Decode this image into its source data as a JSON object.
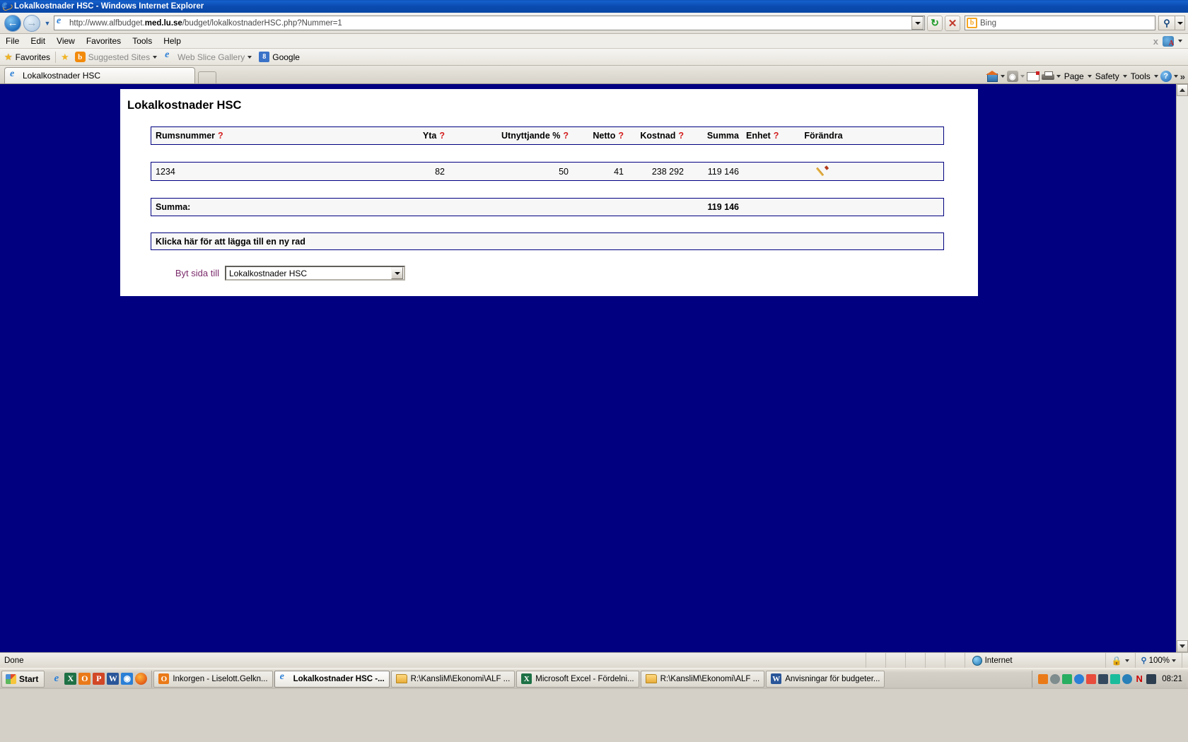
{
  "window": {
    "title": "Lokalkostnader HSC - Windows Internet Explorer",
    "ie_icon": "ie-logo-icon"
  },
  "navigation": {
    "back_icon": "back-arrow-icon",
    "forward_icon": "forward-arrow-icon",
    "history_icon": "chevron-down-icon",
    "address_prefix": "http://www.alfbudget.",
    "address_bold": "med.lu.se",
    "address_suffix": "/budget/lokalkostnaderHSC.php?Nummer=1",
    "address_full": "http://www.alfbudget.med.lu.se/budget/lokalkostnaderHSC.php?Nummer=1",
    "refresh_icon": "refresh-icon",
    "stop_icon": "stop-icon",
    "search_engine": "Bing",
    "search_placeholder": "Bing",
    "search_go_icon": "search-icon",
    "search_dropdown_icon": "chevron-down-icon"
  },
  "menubar": {
    "items": [
      "File",
      "Edit",
      "View",
      "Favorites",
      "Tools",
      "Help"
    ],
    "close_x": "x",
    "pdf_icon": "adobe-pdf-icon"
  },
  "favorites_bar": {
    "favorites_label": "Favorites",
    "add_icon": "add-favorite-icon",
    "items": [
      {
        "label": "Suggested Sites",
        "icon": "orange-o-icon",
        "has_caret": true
      },
      {
        "label": "Web Slice Gallery",
        "icon": "ie-icon",
        "has_caret": true
      },
      {
        "label": "Google",
        "icon": "google-icon",
        "has_caret": false
      }
    ]
  },
  "tabs": {
    "items": [
      {
        "label": "Lokalkostnader HSC",
        "icon": "ie-icon",
        "active": true
      }
    ],
    "new_tab_label": ""
  },
  "command_bar": {
    "home_icon": "home-icon",
    "feeds_icon": "rss-feeds-icon",
    "mail_icon": "mail-icon",
    "print_icon": "print-icon",
    "page_label": "Page",
    "safety_label": "Safety",
    "tools_label": "Tools",
    "help_icon": "help-icon",
    "overflow_label": "»"
  },
  "page": {
    "title": "Lokalkostnader HSC",
    "table": {
      "headers": [
        {
          "label": "Rumsnummer",
          "help": "?"
        },
        {
          "label": "Yta",
          "help": "?"
        },
        {
          "label": "Utnyttjande %",
          "help": "?"
        },
        {
          "label": "Netto",
          "help": "?"
        },
        {
          "label": "Kostnad",
          "help": "?"
        },
        {
          "label": "Summa",
          "help": ""
        },
        {
          "label": "Enhet",
          "help": "?"
        },
        {
          "label": "Förändra",
          "help": ""
        }
      ],
      "rows": [
        {
          "rumsnummer": "1234",
          "yta": "82",
          "utnyttjande": "50",
          "netto": "41",
          "kostnad": "238 292",
          "summa": "119 146",
          "enhet": "",
          "edit_icon": "pencil-edit-icon"
        }
      ],
      "sum_label": "Summa:",
      "sum_value": "119 146",
      "add_row_label": "Klicka här för att lägga till en ny rad"
    },
    "page_switch": {
      "label": "Byt sida till",
      "selected": "Lokalkostnader HSC",
      "dropdown_icon": "chevron-down-icon"
    },
    "colors": {
      "desktop_blue": "#000080",
      "border_navy": "#000080",
      "help_red": "#d42020",
      "label_purple": "#7b2b6b"
    }
  },
  "status_bar": {
    "text": "Done",
    "zone_label": "Internet",
    "zone_icon": "globe-icon",
    "protected_icon": "protected-mode-icon",
    "zoom_icon": "magnifier-icon",
    "zoom_level": "100%",
    "zoom_caret": "chevron-down-icon"
  },
  "taskbar": {
    "start_label": "Start",
    "quick_launch": [
      {
        "icon": "ie-icon",
        "name": "internet-explorer"
      },
      {
        "icon": "excel-icon",
        "name": "excel",
        "letter": "X"
      },
      {
        "icon": "outlook-icon",
        "name": "outlook",
        "letter": "O"
      },
      {
        "icon": "powerpoint-icon",
        "name": "powerpoint",
        "letter": "P"
      },
      {
        "icon": "word-icon",
        "name": "word",
        "letter": "W"
      },
      {
        "icon": "media-icon",
        "name": "media",
        "letter": "▶"
      },
      {
        "icon": "firefox-icon",
        "name": "firefox",
        "letter": ""
      }
    ],
    "tasks": [
      {
        "label": "Inkorgen - Liselott.Gelkn...",
        "icon": "outlook-icon",
        "active": false
      },
      {
        "label": "Lokalkostnader HSC -...",
        "icon": "ie-icon",
        "active": true
      },
      {
        "label": "R:\\KansliM\\Ekonomi\\ALF ...",
        "icon": "folder-icon",
        "active": false
      },
      {
        "label": "Microsoft Excel - Fördelni...",
        "icon": "excel-icon",
        "active": false
      },
      {
        "label": "R:\\KansliM\\Ekonomi\\ALF ...",
        "icon": "folder-icon",
        "active": false
      },
      {
        "label": "Anvisningar för budgeter...",
        "icon": "word-icon",
        "active": false
      }
    ],
    "clock": "08:21",
    "tray_icons": [
      "outlook-tray",
      "shield-tray",
      "network-tray",
      "sound-tray",
      "media-tray",
      "bluetooth-tray",
      "wifi-tray",
      "info-tray",
      "norton-tray",
      "printer-tray"
    ]
  }
}
